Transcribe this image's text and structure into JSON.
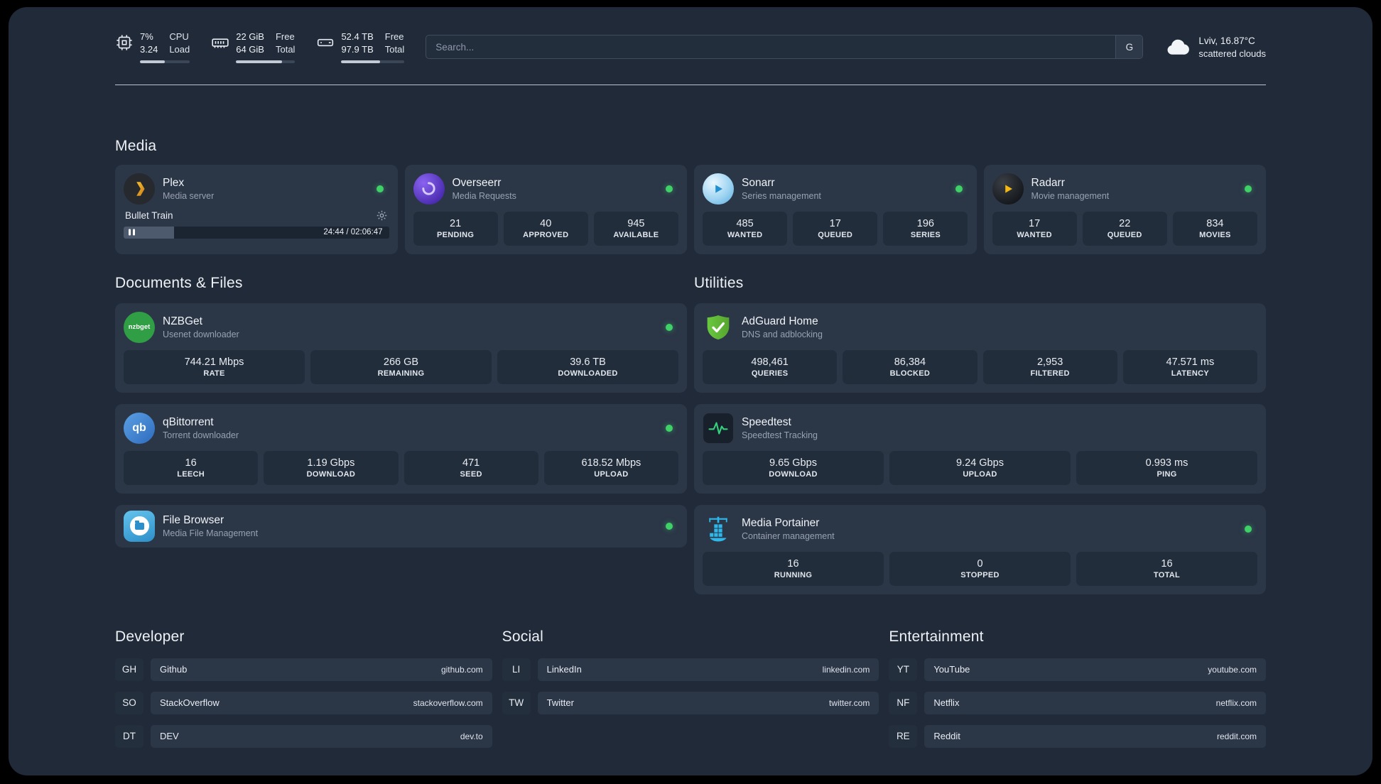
{
  "colors": {
    "status_green": "#3fd168",
    "accent_plex_gold": "#e5a00d",
    "background": "#202a39",
    "card": "#2b3647",
    "stat_box": "#222d3c"
  },
  "topbar": {
    "cpu": {
      "value_top": "7%",
      "value_bottom": "3.24",
      "label_top": "CPU",
      "label_bottom": "Load",
      "fill_percent": 50
    },
    "ram": {
      "value_top": "22 GiB",
      "value_bottom": "64 GiB",
      "label_top": "Free",
      "label_bottom": "Total",
      "fill_percent": 78
    },
    "disk": {
      "value_top": "52.4 TB",
      "value_bottom": "97.9 TB",
      "label_top": "Free",
      "label_bottom": "Total",
      "fill_percent": 62
    },
    "search": {
      "placeholder": "Search...",
      "engine_button": "G"
    },
    "weather": {
      "location": "Lviv, 16.87°C",
      "condition": "scattered clouds"
    }
  },
  "media": {
    "title": "Media",
    "plex": {
      "name": "Plex",
      "subtitle": "Media server",
      "now_playing": "Bullet Train",
      "time": "24:44 / 02:06:47",
      "progress_percent": 19
    },
    "overseerr": {
      "name": "Overseerr",
      "subtitle": "Media Requests",
      "stats": [
        {
          "value": "21",
          "label": "PENDING"
        },
        {
          "value": "40",
          "label": "APPROVED"
        },
        {
          "value": "945",
          "label": "AVAILABLE"
        }
      ]
    },
    "sonarr": {
      "name": "Sonarr",
      "subtitle": "Series management",
      "stats": [
        {
          "value": "485",
          "label": "WANTED"
        },
        {
          "value": "17",
          "label": "QUEUED"
        },
        {
          "value": "196",
          "label": "SERIES"
        }
      ]
    },
    "radarr": {
      "name": "Radarr",
      "subtitle": "Movie management",
      "stats": [
        {
          "value": "17",
          "label": "WANTED"
        },
        {
          "value": "22",
          "label": "QUEUED"
        },
        {
          "value": "834",
          "label": "MOVIES"
        }
      ]
    }
  },
  "documents": {
    "title": "Documents & Files",
    "nzbget": {
      "name": "NZBGet",
      "subtitle": "Usenet downloader",
      "icon_text": "nzbget",
      "stats": [
        {
          "value": "744.21 Mbps",
          "label": "RATE"
        },
        {
          "value": "266 GB",
          "label": "REMAINING"
        },
        {
          "value": "39.6 TB",
          "label": "DOWNLOADED"
        }
      ]
    },
    "qbittorrent": {
      "name": "qBittorrent",
      "subtitle": "Torrent downloader",
      "icon_text": "qb",
      "stats": [
        {
          "value": "16",
          "label": "LEECH"
        },
        {
          "value": "1.19 Gbps",
          "label": "DOWNLOAD"
        },
        {
          "value": "471",
          "label": "SEED"
        },
        {
          "value": "618.52 Mbps",
          "label": "UPLOAD"
        }
      ]
    },
    "filebrowser": {
      "name": "File Browser",
      "subtitle": "Media File Management"
    }
  },
  "utilities": {
    "title": "Utilities",
    "adguard": {
      "name": "AdGuard Home",
      "subtitle": "DNS and adblocking",
      "stats": [
        {
          "value": "498,461",
          "label": "QUERIES"
        },
        {
          "value": "86,384",
          "label": "BLOCKED"
        },
        {
          "value": "2,953",
          "label": "FILTERED"
        },
        {
          "value": "47.571 ms",
          "label": "LATENCY"
        }
      ]
    },
    "speedtest": {
      "name": "Speedtest",
      "subtitle": "Speedtest Tracking",
      "stats": [
        {
          "value": "9.65 Gbps",
          "label": "DOWNLOAD"
        },
        {
          "value": "9.24 Gbps",
          "label": "UPLOAD"
        },
        {
          "value": "0.993 ms",
          "label": "PING"
        }
      ]
    },
    "portainer": {
      "name": "Media Portainer",
      "subtitle": "Container management",
      "stats": [
        {
          "value": "16",
          "label": "RUNNING"
        },
        {
          "value": "0",
          "label": "STOPPED"
        },
        {
          "value": "16",
          "label": "TOTAL"
        }
      ]
    }
  },
  "bookmarks": {
    "developer": {
      "title": "Developer",
      "items": [
        {
          "abbr": "GH",
          "name": "Github",
          "url": "github.com"
        },
        {
          "abbr": "SO",
          "name": "StackOverflow",
          "url": "stackoverflow.com"
        },
        {
          "abbr": "DT",
          "name": "DEV",
          "url": "dev.to"
        }
      ]
    },
    "social": {
      "title": "Social",
      "items": [
        {
          "abbr": "LI",
          "name": "LinkedIn",
          "url": "linkedin.com"
        },
        {
          "abbr": "TW",
          "name": "Twitter",
          "url": "twitter.com"
        }
      ]
    },
    "entertainment": {
      "title": "Entertainment",
      "items": [
        {
          "abbr": "YT",
          "name": "YouTube",
          "url": "youtube.com"
        },
        {
          "abbr": "NF",
          "name": "Netflix",
          "url": "netflix.com"
        },
        {
          "abbr": "RE",
          "name": "Reddit",
          "url": "reddit.com"
        }
      ]
    }
  }
}
